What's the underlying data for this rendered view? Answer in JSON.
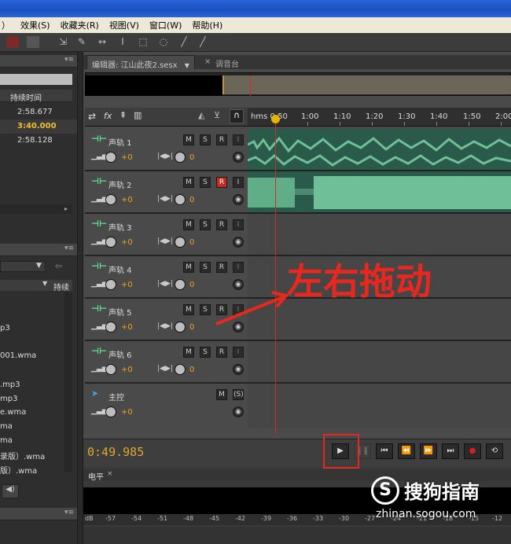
{
  "menu": [
    "）",
    "效果(S)",
    "收藏夹(R)",
    "视图(V)",
    "窗口(W)",
    "帮助(H)"
  ],
  "left_panel": {
    "col_duration": "持续时间",
    "durations": [
      "2:58.677",
      "3:40.000",
      "2:58.128"
    ],
    "col_duration2": "持续",
    "files": [
      "p3",
      "001.wma",
      ".mp3",
      "mp3",
      "e.wma",
      "ma",
      "ma",
      "录版）.wma",
      "版）.wma"
    ]
  },
  "tabs": {
    "editor": "编辑器: 江山此夜2.sesx",
    "editor_menu": "▼",
    "close": "×",
    "mixer": "调音台"
  },
  "ruler": {
    "labels": [
      "hms 0:50",
      "1:00",
      "1:10",
      "1:20",
      "1:30",
      "1:40",
      "1:50",
      "2:00"
    ]
  },
  "tracks": [
    {
      "name": "声轨 1",
      "vol": "+0",
      "pan": "0",
      "rec": false
    },
    {
      "name": "声轨 2",
      "vol": "+0",
      "pan": "0",
      "rec": true
    },
    {
      "name": "声轨 3",
      "vol": "+0",
      "pan": "0",
      "rec": false
    },
    {
      "name": "声轨 4",
      "vol": "+0",
      "pan": "0",
      "rec": false
    },
    {
      "name": "声轨 5",
      "vol": "+0",
      "pan": "0",
      "rec": false
    },
    {
      "name": "声轨 6",
      "vol": "+0",
      "pan": "0",
      "rec": false
    }
  ],
  "master": {
    "name": "主控",
    "vol": "+0"
  },
  "buttons": {
    "m": "M",
    "s": "S",
    "r": "R",
    "i": "I",
    "ms": "(S)"
  },
  "annotation": "左右拖动",
  "transport": {
    "timecode": "0:49.985"
  },
  "level_panel": {
    "title": "电平",
    "scale": [
      "dB",
      "-57",
      "-54",
      "-51",
      "-48",
      "-45",
      "-42",
      "-39",
      "-36",
      "-33",
      "-30",
      "-27",
      "-24",
      "-21",
      "-18",
      "-15",
      "-12"
    ]
  },
  "watermark": {
    "brand": "搜狗指南",
    "url": "zhinan.sogou.com"
  }
}
